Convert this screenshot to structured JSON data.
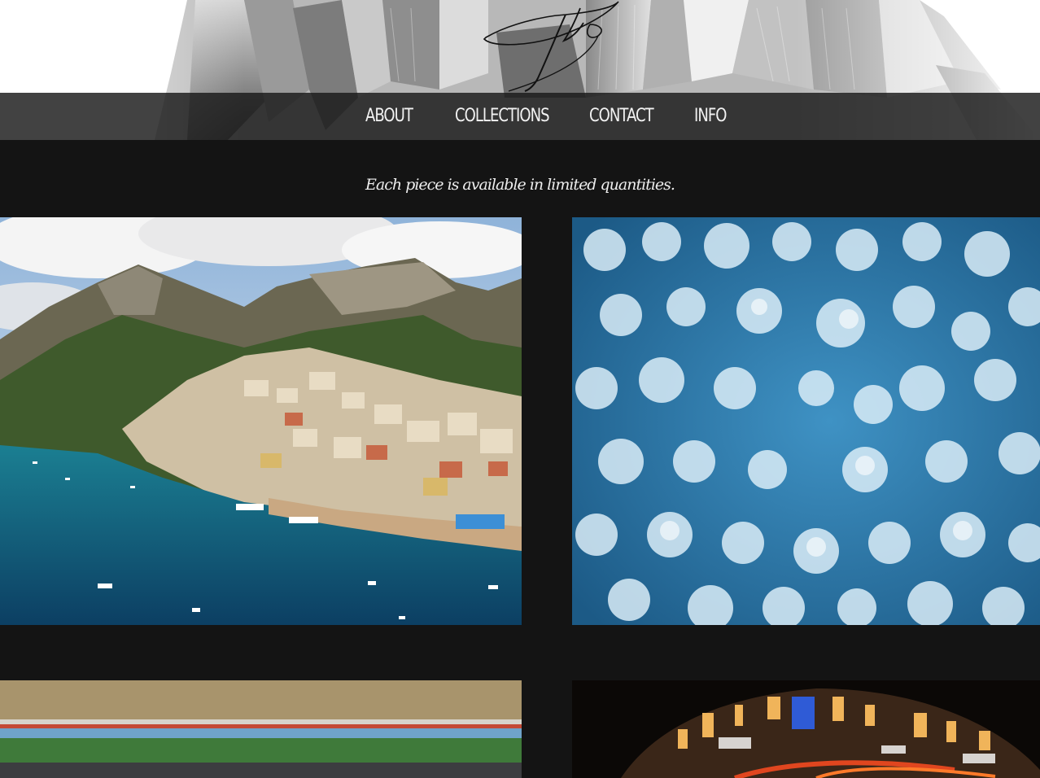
{
  "site": {
    "logo_name": "signature-logo"
  },
  "nav": {
    "items": [
      {
        "label": "ABOUT"
      },
      {
        "label": "COLLECTIONS"
      },
      {
        "label": "CONTACT"
      },
      {
        "label": "INFO"
      }
    ]
  },
  "main": {
    "tagline": "Each piece is available in limited quantities.",
    "gallery": [
      {
        "subject": "coastal village aerial"
      },
      {
        "subject": "snowy forest aerial"
      },
      {
        "subject": "stadium track aerial"
      },
      {
        "subject": "city at night aerial"
      }
    ]
  },
  "colors": {
    "background": "#141414",
    "nav_bg": "#1c1c1c",
    "nav_text": "#f2f2f2",
    "header_bg": "#ffffff"
  }
}
